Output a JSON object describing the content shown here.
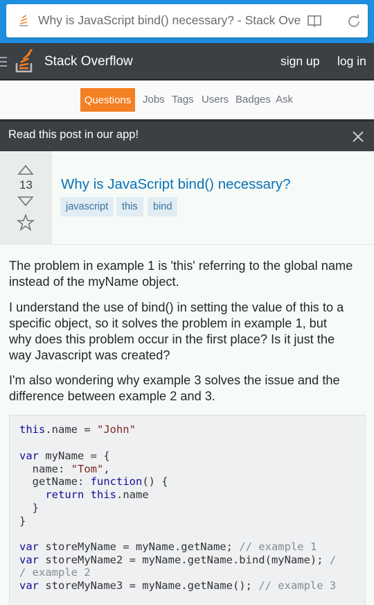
{
  "browser": {
    "url_title": "Why is JavaScript bind() necessary? - Stack Over",
    "reader_icon": "book-open-icon",
    "reload_icon": "refresh-icon"
  },
  "header": {
    "site_title": "Stack Overflow",
    "signup": "sign up",
    "login": "log in",
    "colors": {
      "bar": "#3b4045",
      "accent": "#f48024"
    }
  },
  "nav": {
    "items": [
      "Questions",
      "Jobs",
      "Tags",
      "Users",
      "Badges",
      "Ask"
    ],
    "active": "Questions"
  },
  "banner": {
    "text": "Read this post in our app!"
  },
  "question": {
    "votes": "13",
    "title": "Why is JavaScript bind() necessary?",
    "tags": [
      "javascript",
      "this",
      "bind"
    ]
  },
  "body": {
    "paragraphs": [
      [
        "The problem in example 1 is 'this' referring to the global name",
        "instead of the myName object."
      ],
      [
        "I understand the use of bind() in setting the value of this to a",
        "specific object, so it solves the problem in example 1, but",
        "why does this problem occur in the first place? Is it just the",
        "way Javascript was created?"
      ],
      [
        "I'm also wondering why example 3 solves the issue and the",
        "difference between example 2 and 3."
      ]
    ],
    "code": {
      "l1_kw": "this",
      "l1_rest": ".name = ",
      "l1_str": "\"John\"",
      "l3_kw": "var",
      "l3_rest": " myName = {",
      "l4_rest": "  name: ",
      "l4_str": "\"Tom\"",
      "l4_end": ",",
      "l5_rest": "  getName: ",
      "l5_kw": "function",
      "l5_end": "() {",
      "l6_kw": "return",
      "l6_kw2": "this",
      "l6_end": ".name",
      "l7": "  }",
      "l8": "}",
      "l10_kw": "var",
      "l10_rest": " storeMyName = myName.getName; ",
      "l10_cmt": "// example 1",
      "l11_kw": "var",
      "l11_rest": " storeMyName2 = myName.getName.bind(myName); ",
      "l11_cmt": "/",
      "l12_cmt": "/ example 2",
      "l13_kw": "var",
      "l13_rest": " storeMyName3 = myName.getName(); ",
      "l13_cmt": "// example 3"
    }
  }
}
